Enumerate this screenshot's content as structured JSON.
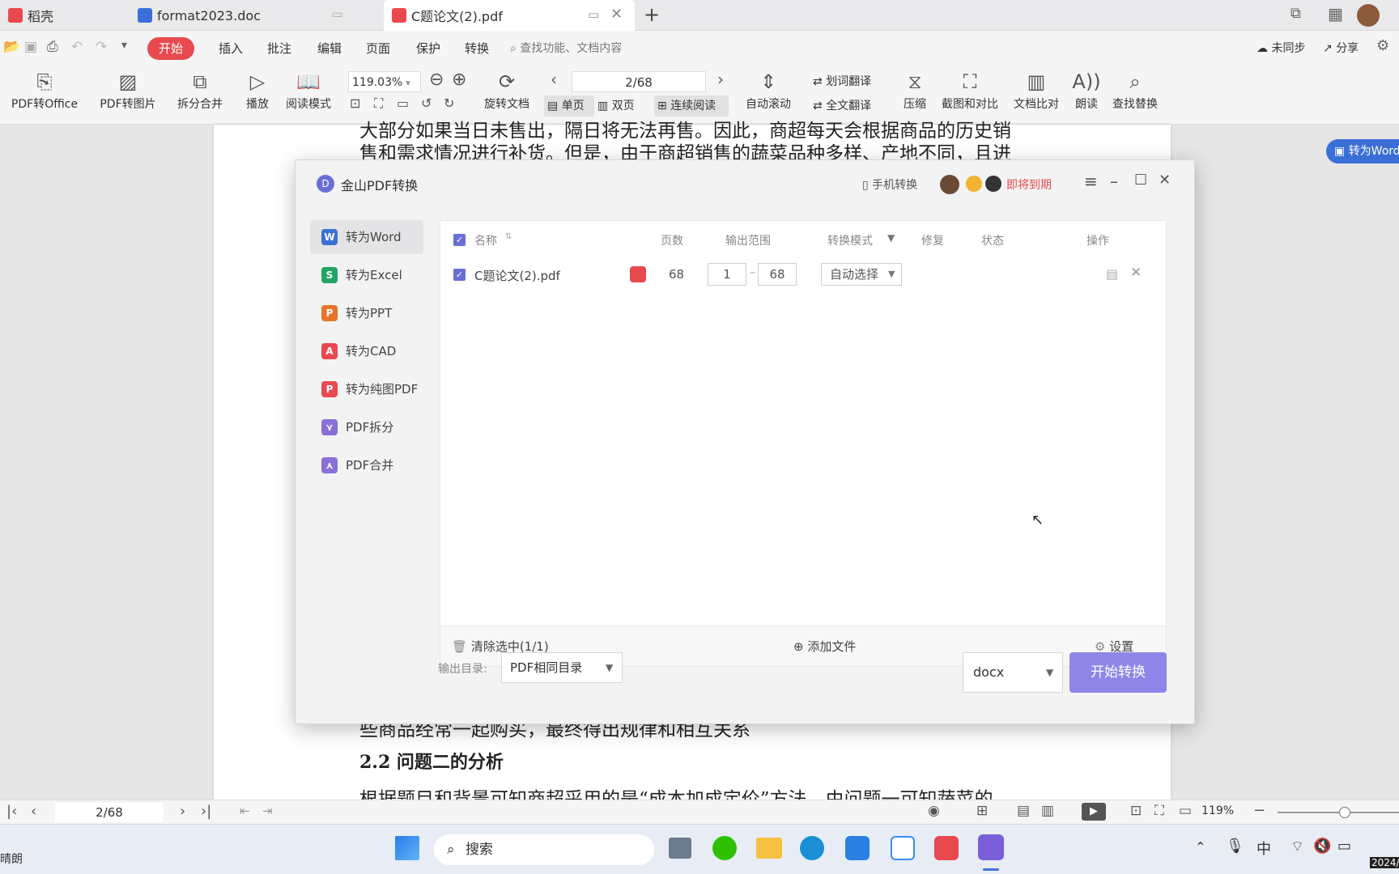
{
  "tabs": [
    {
      "label": "稻壳",
      "icon": "daoke-icon",
      "color": "#e8494f"
    },
    {
      "label": "format2023.doc",
      "icon": "word-icon",
      "color": "#3b6fd8"
    },
    {
      "label": "C题论文(2).pdf",
      "icon": "pdf-icon",
      "color": "#e8494f"
    }
  ],
  "menu": {
    "items": [
      "开始",
      "插入",
      "批注",
      "编辑",
      "页面",
      "保护",
      "转换"
    ],
    "search_placeholder": "查找功能、文档内容",
    "sync": "未同步",
    "share": "分享"
  },
  "toolbar": {
    "pdf_to_office": "PDF转Office",
    "pdf_to_image": "PDF转图片",
    "split_merge": "拆分合并",
    "play": "播放",
    "read_mode": "阅读模式",
    "zoom": "119.03%",
    "rotate_doc": "旋转文档",
    "page": "2/68",
    "single_page": "单页",
    "double_page": "双页",
    "continuous": "连续阅读",
    "auto_scroll": "自动滚动",
    "word_translate": "划词翻译",
    "full_translate": "全文翻译",
    "compress": "压缩",
    "screenshot_compare": "截图和对比",
    "doc_compare": "文档比对",
    "read_aloud": "朗读",
    "find_replace": "查找替换"
  },
  "document": {
    "line1": "大部分如果当日未售出，隔日将无法再售。因此，商超每天会根据商品的历史销",
    "line2": "售和需求情况进行补货。但是，由于商超销售的蔬菜品种多样、产地不同，且进",
    "line3": "些商品经常一起购买，最终得出规律和相互关系",
    "heading": "2.2 问题二的分析",
    "line4": "根据题目和背景可知商超采用的是“成本加成定价”方法，由问题一可知蔬菜的",
    "float_button": "转为Word"
  },
  "dialog": {
    "title": "金山PDF转换",
    "phone_convert": "手机转换",
    "expire": "即将到期",
    "sidebar": [
      {
        "label": "转为Word",
        "icon": "word-icon",
        "glyph": "W",
        "color": "#3b6fd8"
      },
      {
        "label": "转为Excel",
        "icon": "excel-icon",
        "glyph": "S",
        "color": "#22a565"
      },
      {
        "label": "转为PPT",
        "icon": "ppt-icon",
        "glyph": "P",
        "color": "#e8742b"
      },
      {
        "label": "转为CAD",
        "icon": "cad-icon",
        "glyph": "A",
        "color": "#e8494f"
      },
      {
        "label": "转为纯图PDF",
        "icon": "image-pdf-icon",
        "glyph": "P",
        "color": "#e8494f"
      },
      {
        "label": "PDF拆分",
        "icon": "split-icon",
        "glyph": "⋎",
        "color": "#8a6fd8"
      },
      {
        "label": "PDF合并",
        "icon": "merge-icon",
        "glyph": "⋏",
        "color": "#8a6fd8"
      }
    ],
    "headers": {
      "name": "名称",
      "pages": "页数",
      "range": "输出范围",
      "mode": "转换模式",
      "repair": "修复",
      "status": "状态",
      "ops": "操作"
    },
    "file": {
      "name": "C题论文(2).pdf",
      "pages": "68",
      "range_from": "1",
      "range_to": "68",
      "mode": "自动选择"
    },
    "clear": "清除选中(1/1)",
    "add_file": "添加文件",
    "settings": "设置",
    "output_label": "输出目录:",
    "output_dir": "PDF相同目录",
    "format": "docx",
    "start": "开始转换"
  },
  "statusbar": {
    "page": "2/68",
    "zoom": "119%"
  },
  "taskbar": {
    "weather": "晴朗",
    "search": "搜索",
    "ime": "中",
    "year": "2024/"
  }
}
